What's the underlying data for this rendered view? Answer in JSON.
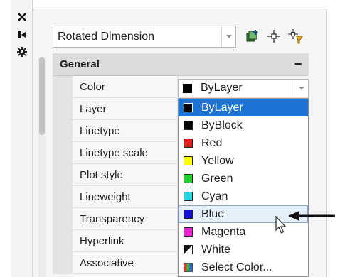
{
  "palette": {
    "object_type": "Rotated Dimension",
    "strip_icons": [
      "close-icon",
      "autohide-icon",
      "properties-icon"
    ],
    "tool_icons": [
      "toggle-pickadd-icon",
      "select-objects-icon",
      "quick-select-icon"
    ]
  },
  "category": {
    "title": "General",
    "collapse_symbol": "−"
  },
  "properties": [
    {
      "name": "Color"
    },
    {
      "name": "Layer"
    },
    {
      "name": "Linetype"
    },
    {
      "name": "Linetype scale"
    },
    {
      "name": "Plot style"
    },
    {
      "name": "Lineweight"
    },
    {
      "name": "Transparency"
    },
    {
      "name": "Hyperlink"
    },
    {
      "name": "Associative"
    }
  ],
  "color_combo": {
    "value": "ByLayer",
    "swatch": "#000000"
  },
  "color_options": [
    {
      "label": "ByLayer",
      "swatch": "#000000",
      "state": "selected"
    },
    {
      "label": "ByBlock",
      "swatch": "#000000",
      "state": ""
    },
    {
      "label": "Red",
      "swatch": "#e0201b",
      "state": ""
    },
    {
      "label": "Yellow",
      "swatch": "#ffff00",
      "state": ""
    },
    {
      "label": "Green",
      "swatch": "#22d22a",
      "state": ""
    },
    {
      "label": "Cyan",
      "swatch": "#22d6df",
      "state": ""
    },
    {
      "label": "Blue",
      "swatch": "#1212d8",
      "state": "hover"
    },
    {
      "label": "Magenta",
      "swatch": "#ee22d6",
      "state": ""
    },
    {
      "label": "White",
      "swatch": "white-diagonal",
      "state": ""
    },
    {
      "label": "Select Color...",
      "swatch": "color-picker-icon",
      "state": ""
    }
  ],
  "colors": {
    "selection": "#1c73d3",
    "hover": "#e6f0fb"
  }
}
